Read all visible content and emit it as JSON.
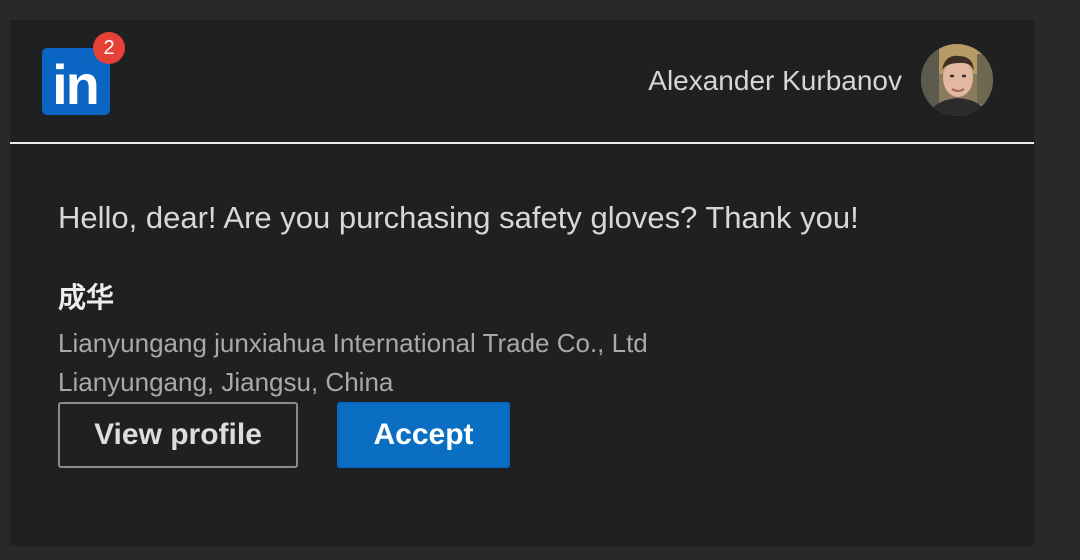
{
  "header": {
    "logo_text": "in",
    "notification_count": "2",
    "user_name": "Alexander Kurbanov"
  },
  "message": {
    "text": "Hello, dear! Are you purchasing safety gloves? Thank you!"
  },
  "sender": {
    "name": "成华",
    "company": "Lianyungang junxiahua International Trade Co., Ltd",
    "location": "Lianyungang, Jiangsu, China"
  },
  "actions": {
    "view_profile_label": "View profile",
    "accept_label": "Accept"
  },
  "colors": {
    "brand_blue": "#0a66c2",
    "badge_red": "#e74137",
    "card_background": "#1f2022",
    "page_background": "#28292b"
  },
  "icons": {
    "logo": "linkedin-logo",
    "avatar": "user-avatar-photo"
  }
}
